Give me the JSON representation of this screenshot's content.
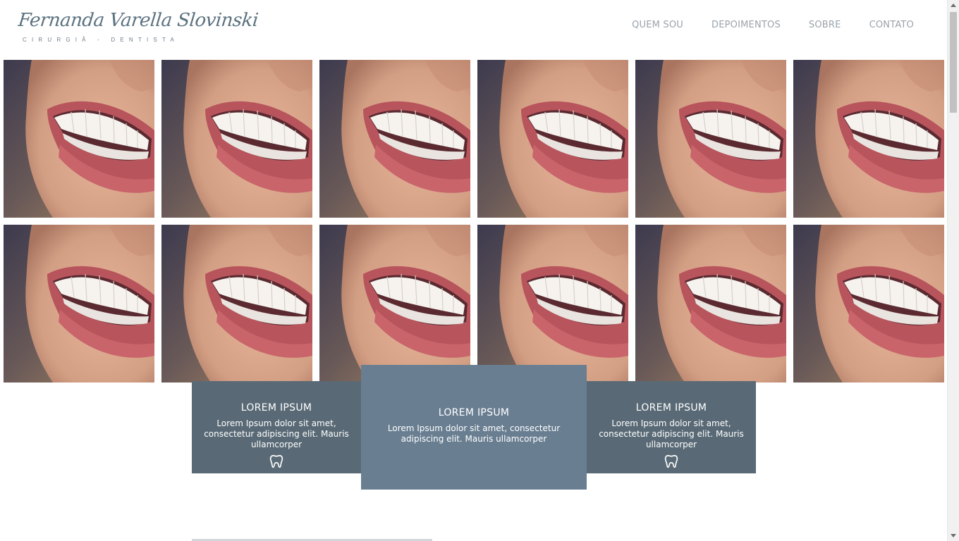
{
  "brand": {
    "name": "Fernanda Varella Slovinski",
    "tagline": "CIRURGIÃ - DENTISTA"
  },
  "nav": {
    "items": [
      {
        "label": "QUEM SOU"
      },
      {
        "label": "DEPOIMENTOS"
      },
      {
        "label": "SOBRE"
      },
      {
        "label": "CONTATO"
      }
    ]
  },
  "gallery": {
    "photo_subject": "smile",
    "rows": 2,
    "columns": 6
  },
  "cards": [
    {
      "title": "LOREM IPSUM",
      "text": "Lorem Ipsum dolor sit amet, consectetur adipiscing elit. Mauris ullamcorper",
      "icon": "tooth-icon"
    },
    {
      "title": "LOREM IPSUM",
      "text": "Lorem Ipsum dolor sit amet, consectetur adipiscing elit. Mauris ullamcorper",
      "icon": ""
    },
    {
      "title": "LOREM IPSUM",
      "text": "Lorem Ipsum dolor sit amet, consectetur adipiscing elit. Mauris ullamcorper",
      "icon": "tooth-icon"
    }
  ],
  "colors": {
    "card_side": "#596a76",
    "card_center": "#697e91",
    "nav_text": "#9aa3aa",
    "brand": "#5c7280"
  }
}
